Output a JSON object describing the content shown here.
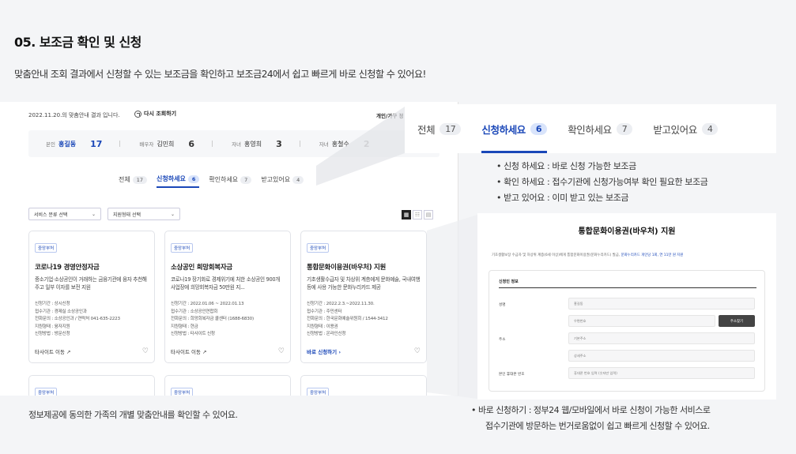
{
  "heading": {
    "title": "05. 보조금 확인 및 신청",
    "subtitle": "맞춤안내 조회 결과에서 신청할 수 있는 보조금을 확인하고 보조금24에서 쉽고 빠르게 바로 신청할 수 있어요!"
  },
  "screen": {
    "notice": "2022.11.20.의 맞춤안내 결과 입니다.",
    "refresh_label": "다시 조회하기",
    "personal_link": "개인/가구 정",
    "family": [
      {
        "role": "본인",
        "name": "홍길동",
        "count": "17"
      },
      {
        "role": "배우자",
        "name": "김민희",
        "count": "6"
      },
      {
        "role": "자녀",
        "name": "홍영희",
        "count": "3"
      },
      {
        "role": "자녀",
        "name": "홍철수",
        "count": "2"
      }
    ],
    "tabs": [
      {
        "label": "전체",
        "count": "17"
      },
      {
        "label": "신청하세요",
        "count": "6"
      },
      {
        "label": "확인하세요",
        "count": "7"
      },
      {
        "label": "받고있어요",
        "count": "4"
      }
    ],
    "filters": {
      "service_select": "서비스 분류 선택",
      "support_select": "지원형태 선택"
    },
    "cards": [
      {
        "tag": "중앙부처",
        "title": "코로나19 경영안정자금",
        "desc": "중소기업·소상공인이 거래하는 금융기관에 융자 추천해주고 일부 이자를 보전 지원",
        "details": [
          "신청기간 : 상시신청",
          "접수기관 : 경제실 소상공인과",
          "전화문의 : 소상공인과 / 연락처 041-635-2223",
          "지원형태 : 융자지원",
          "신청방법 : 방문신청"
        ],
        "link": "타사이트 이동 ↗"
      },
      {
        "tag": "중앙부처",
        "title": "소상공인 희망회복자금",
        "desc": "코로나19 장기화로 경제위기에 처한 소상공인 900개 사업장에 희망회복자금 50만원 지...",
        "details": [
          "신청기간 : 2022.01.06 ~ 2022.01.13",
          "접수기관 : 소상공인연합회",
          "전화문의 : 희망회복자금 콜센터 (1688-6830)",
          "지원형태 : 현금",
          "신청방법 : 타사이트 신청"
        ],
        "link": "타사이트 이동 ↗"
      },
      {
        "tag": "중앙부처",
        "title": "통합문화이용권(바우처) 지원",
        "desc": "기초생활수급자 및 차상위 계층에게 문화예술, 국내여행 등에 사용 가능한 문화누리카드 제공",
        "details": [
          "신청기간 : 2022.2.3.~2022.11.30.",
          "접수기관 : 주민센터",
          "전화문의 : 한국문화예술위원회 / 1544-3412",
          "지원형태 : 이용권",
          "신청방법 : 온라인신청"
        ],
        "link": "바로 신청하기 ›"
      }
    ],
    "more_tags": [
      "중앙부처",
      "중앙부처",
      "중앙부처"
    ]
  },
  "left_caption": "정보제공에 동의한 가족의 개별 맞춤안내를 확인할 수 있어요.",
  "zoom_tabs": [
    {
      "label": "전체",
      "count": "17"
    },
    {
      "label": "신청하세요",
      "count": "6"
    },
    {
      "label": "확인하세요",
      "count": "7"
    },
    {
      "label": "받고있어요",
      "count": "4"
    }
  ],
  "bullets": [
    "• 신청 하세요 : 바로 신청 가능한 보조금",
    "• 확인 하세요 : 접수기관에 신청가능여부 확인 필요한 보조금",
    "• 받고 있어요 : 이미 받고 있는 보조금"
  ],
  "form": {
    "title": "통합문화이용권(바우처) 지원",
    "note": "기초생활보장 수급자 및 차상위 계층(6세 이상)에게 통합문화이용권(문화누리카드) 발급, ",
    "note_link": "문화누리카드 개인당 1회, 연 11만 원 지원",
    "section": "신청인 정보",
    "name_label": "성명",
    "name_value": "홍길동",
    "zip_placeholder": "우편번호",
    "addr_button": "주소찾기",
    "addr_label": "주소",
    "addr1_placeholder": "기본주소",
    "addr2_placeholder": "상세주소",
    "phone_label": "본인 휴대폰 번호",
    "phone_placeholder": "휴대폰 번호 입력 (숫자만 입력)"
  },
  "right_caption": [
    "• 바로 신청하기 : 정부24 웹/모바일에서 바로 신청이 가능한 서비스로",
    "접수기관에 방문하는 번거로움없이 쉽고 빠르게 신청할 수 있어요."
  ],
  "colors": {
    "accent": "#1a47b8",
    "background": "#f4f5f7"
  }
}
